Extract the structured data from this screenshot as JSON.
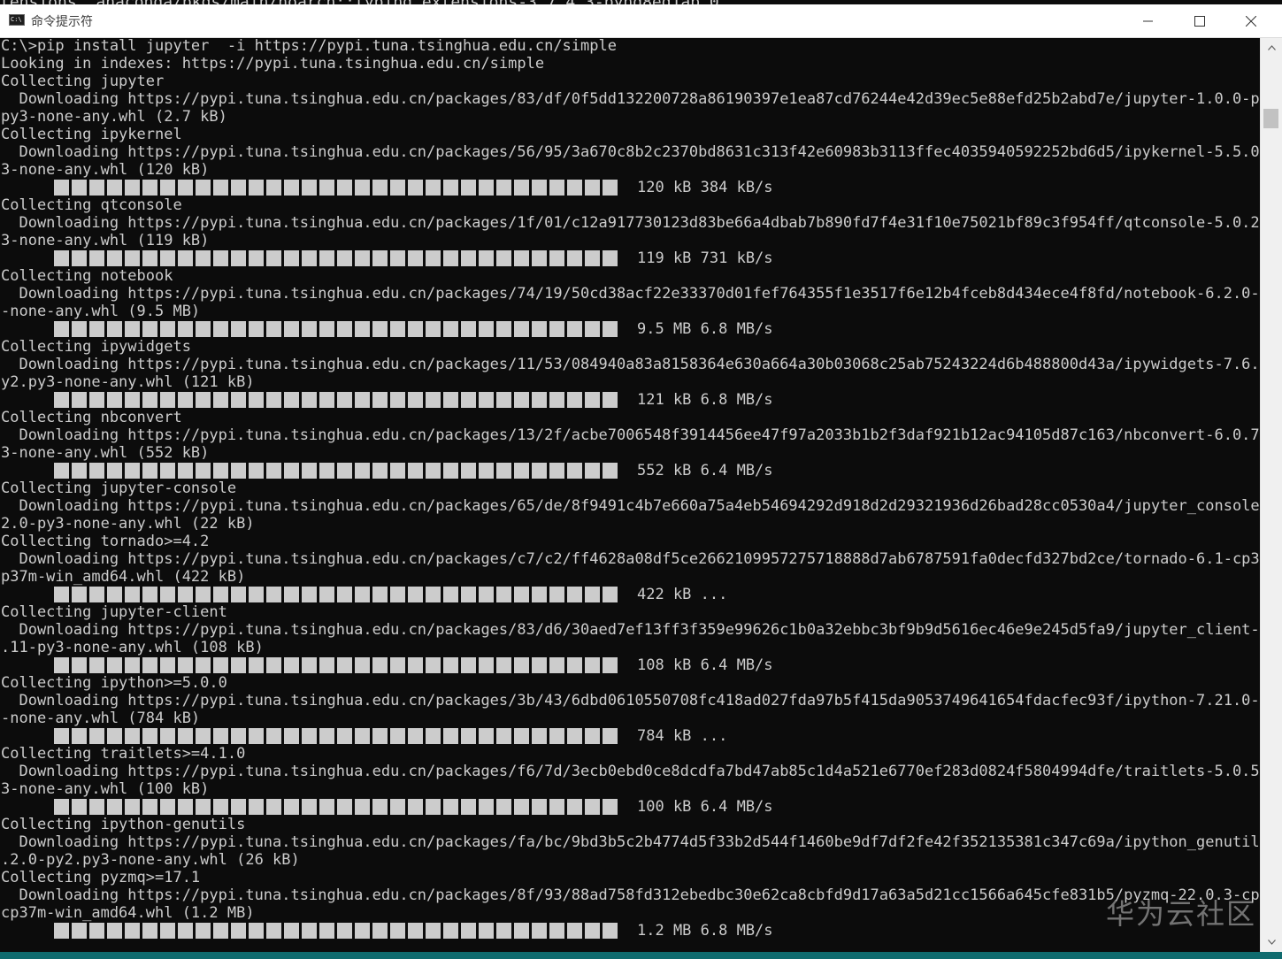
{
  "window": {
    "title": "命令提示符",
    "behind_text": "tensions  anaconda/pkgs/main/noarch::typing_extensions-3.7.4.3-pyhd8ed1ab_0"
  },
  "watermark": "华为云社区",
  "console": {
    "lines": [
      {
        "text": "C:\\>pip install jupyter  -i https://pypi.tuna.tsinghua.edu.cn/simple"
      },
      {
        "text": "Looking in indexes: https://pypi.tuna.tsinghua.edu.cn/simple"
      },
      {
        "text": "Collecting jupyter"
      },
      {
        "text": "  Downloading https://pypi.tuna.tsinghua.edu.cn/packages/83/df/0f5dd132200728a86190397e1ea87cd76244e42d39ec5e88efd25b2abd7e/jupyter-1.0.0-py2."
      },
      {
        "text": "py3-none-any.whl (2.7 kB)"
      },
      {
        "text": "Collecting ipykernel"
      },
      {
        "text": "  Downloading https://pypi.tuna.tsinghua.edu.cn/packages/56/95/3a670c8b2c2370bd8631c313f42e60983b3113ffec4035940592252bd6d5/ipykernel-5.5.0-py"
      },
      {
        "text": "3-none-any.whl (120 kB)"
      },
      {
        "progress": "120 kB 384 kB/s"
      },
      {
        "text": "Collecting qtconsole"
      },
      {
        "text": "  Downloading https://pypi.tuna.tsinghua.edu.cn/packages/1f/01/c12a917730123d83be66a4dbab7b890fd7f4e31f10e75021bf89c3f954ff/qtconsole-5.0.2-py"
      },
      {
        "text": "3-none-any.whl (119 kB)"
      },
      {
        "progress": "119 kB 731 kB/s"
      },
      {
        "text": "Collecting notebook"
      },
      {
        "text": "  Downloading https://pypi.tuna.tsinghua.edu.cn/packages/74/19/50cd38acf22e33370d01fef764355f1e3517f6e12b4fceb8d434ece4f8fd/notebook-6.2.0-py3"
      },
      {
        "text": "-none-any.whl (9.5 MB)"
      },
      {
        "progress": "9.5 MB 6.8 MB/s"
      },
      {
        "text": "Collecting ipywidgets"
      },
      {
        "text": "  Downloading https://pypi.tuna.tsinghua.edu.cn/packages/11/53/084940a83a8158364e630a664a30b03068c25ab75243224d6b488800d43a/ipywidgets-7.6.3-p"
      },
      {
        "text": "y2.py3-none-any.whl (121 kB)"
      },
      {
        "progress": "121 kB 6.8 MB/s"
      },
      {
        "text": "Collecting nbconvert"
      },
      {
        "text": "  Downloading https://pypi.tuna.tsinghua.edu.cn/packages/13/2f/acbe7006548f3914456ee47f97a2033b1b2f3daf921b12ac94105d87c163/nbconvert-6.0.7-py"
      },
      {
        "text": "3-none-any.whl (552 kB)"
      },
      {
        "progress": "552 kB 6.4 MB/s"
      },
      {
        "text": "Collecting jupyter-console"
      },
      {
        "text": "  Downloading https://pypi.tuna.tsinghua.edu.cn/packages/65/de/8f9491c4b7e660a75a4eb54694292d918d2d29321936d26bad28cc0530a4/jupyter_console-6."
      },
      {
        "text": "2.0-py3-none-any.whl (22 kB)"
      },
      {
        "text": "Collecting tornado>=4.2"
      },
      {
        "text": "  Downloading https://pypi.tuna.tsinghua.edu.cn/packages/c7/c2/ff4628a08df5ce2662109957275718888d7ab6787591fa0decfd327bd2ce/tornado-6.1-cp37-c"
      },
      {
        "text": "p37m-win_amd64.whl (422 kB)"
      },
      {
        "progress": "422 kB ..."
      },
      {
        "text": "Collecting jupyter-client"
      },
      {
        "text": "  Downloading https://pypi.tuna.tsinghua.edu.cn/packages/83/d6/30aed7ef13ff3f359e99626c1b0a32ebbc3bf9b9d5616ec46e9e245d5fa9/jupyter_client-6.1"
      },
      {
        "text": ".11-py3-none-any.whl (108 kB)"
      },
      {
        "progress": "108 kB 6.4 MB/s"
      },
      {
        "text": "Collecting ipython>=5.0.0"
      },
      {
        "text": "  Downloading https://pypi.tuna.tsinghua.edu.cn/packages/3b/43/6dbd0610550708fc418ad027fda97b5f415da9053749641654fdacfec93f/ipython-7.21.0-py3"
      },
      {
        "text": "-none-any.whl (784 kB)"
      },
      {
        "progress": "784 kB ..."
      },
      {
        "text": "Collecting traitlets>=4.1.0"
      },
      {
        "text": "  Downloading https://pypi.tuna.tsinghua.edu.cn/packages/f6/7d/3ecb0ebd0ce8dcdfa7bd47ab85c1d4a521e6770ef283d0824f5804994dfe/traitlets-5.0.5-py"
      },
      {
        "text": "3-none-any.whl (100 kB)"
      },
      {
        "progress": "100 kB 6.4 MB/s"
      },
      {
        "text": "Collecting ipython-genutils"
      },
      {
        "text": "  Downloading https://pypi.tuna.tsinghua.edu.cn/packages/fa/bc/9bd3b5c2b4774d5f33b2d544f1460be9df7df2fe42f352135381c347c69a/ipython_genutils-0"
      },
      {
        "text": ".2.0-py2.py3-none-any.whl (26 kB)"
      },
      {
        "text": "Collecting pyzmq>=17.1"
      },
      {
        "text": "  Downloading https://pypi.tuna.tsinghua.edu.cn/packages/8f/93/88ad758fd312ebedbc30e62ca8cbfd9d17a63a5d21cc1566a645cfe831b5/pyzmq-22.0.3-cp37-"
      },
      {
        "text": "cp37m-win_amd64.whl (1.2 MB)"
      },
      {
        "progress": "1.2 MB 6.8 MB/s"
      }
    ]
  }
}
